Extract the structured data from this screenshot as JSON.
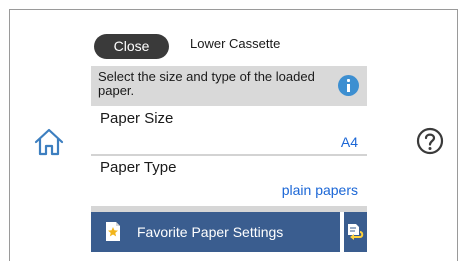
{
  "header": {
    "close_label": "Close",
    "title": "Lower Cassette"
  },
  "info": {
    "message": "Select the size and type of the loaded paper.",
    "icon": "info-icon"
  },
  "settings": {
    "paper_size": {
      "label": "Paper Size",
      "value": "A4"
    },
    "paper_type": {
      "label": "Paper Type",
      "value": "plain papers"
    }
  },
  "footer": {
    "favorite_label": "Favorite Paper Settings",
    "favorite_icon": "favorite-document-icon",
    "side_icon": "paper-settings-return-icon"
  },
  "nav": {
    "home_icon": "home-icon",
    "help_icon": "help-icon"
  },
  "colors": {
    "accent_blue": "#1a66d6",
    "button_blue": "#3a5d8f",
    "info_blue": "#3d8fd1",
    "close_bg": "#3a3a3a"
  }
}
